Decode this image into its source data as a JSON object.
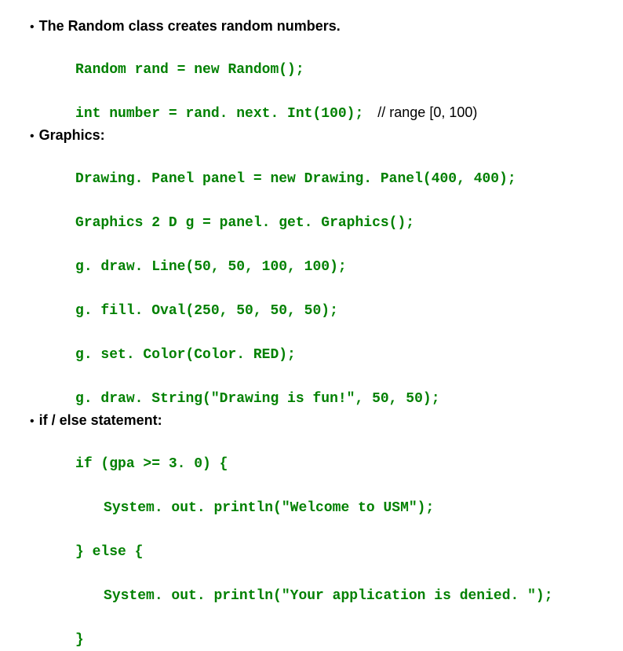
{
  "bullets": {
    "b1": "The Random class creates random numbers.",
    "b2": "Graphics:",
    "b3": "if / else statement:"
  },
  "code": {
    "random1": "Random rand = new Random();",
    "random2": "int number = rand. next. Int(100);",
    "random2_comment": "// range [0, 100)",
    "gfx1": "Drawing. Panel panel = new Drawing. Panel(400, 400);",
    "gfx2": "Graphics 2 D g = panel. get. Graphics();",
    "gfx3": "g. draw. Line(50, 50, 100, 100);",
    "gfx4": "g. fill. Oval(250, 50, 50, 50);",
    "gfx5": "g. set. Color(Color. RED);",
    "gfx6": "g. draw. String(\"Drawing is fun!\", 50, 50);",
    "if1": "if (gpa >= 3. 0) {",
    "if2": "System. out. println(\"Welcome to USM\");",
    "if3": "} else {",
    "if4": "System. out. println(\"Your application is denied. \");",
    "if5": "}"
  }
}
